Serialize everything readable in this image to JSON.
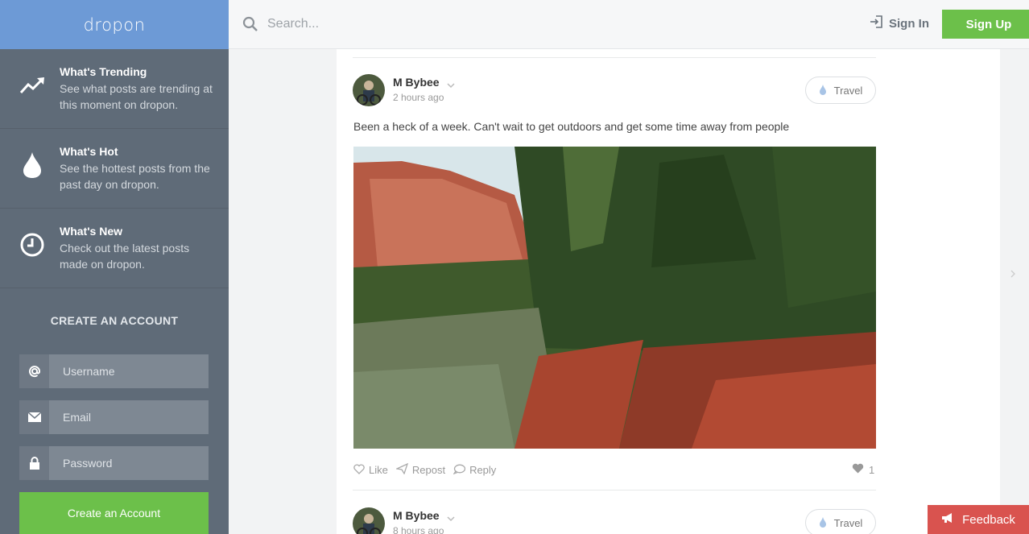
{
  "app": {
    "logo": "dropon"
  },
  "sidebar": {
    "nav": [
      {
        "title": "What's Trending",
        "desc": "See what posts are trending at this moment on dropon.",
        "icon": "trending-icon"
      },
      {
        "title": "What's Hot",
        "desc": "See the hottest posts from the past day on dropon.",
        "icon": "flame-icon"
      },
      {
        "title": "What's New",
        "desc": "Check out the latest posts made on dropon.",
        "icon": "clock-icon"
      }
    ],
    "create_heading": "CREATE AN ACCOUNT",
    "username_placeholder": "Username",
    "email_placeholder": "Email",
    "password_placeholder": "Password",
    "create_button": "Create an Account"
  },
  "header": {
    "search_placeholder": "Search...",
    "sign_in": "Sign In",
    "sign_up": "Sign Up"
  },
  "posts": [
    {
      "author": "M Bybee",
      "time": "2 hours ago",
      "tag": "Travel",
      "text": "Been a heck of a week. Can't wait to get outdoors and get some time away from people",
      "actions": {
        "like": "Like",
        "repost": "Repost",
        "reply": "Reply"
      },
      "likes": "1"
    },
    {
      "author": "M Bybee",
      "time": "8 hours ago",
      "tag": "Travel"
    }
  ],
  "feedback": "Feedback",
  "colors": {
    "accent_green": "#6cc04a",
    "logo_blue": "#6d9ad6",
    "sidebar": "#5f6b78",
    "feedback_red": "#d9534f"
  }
}
